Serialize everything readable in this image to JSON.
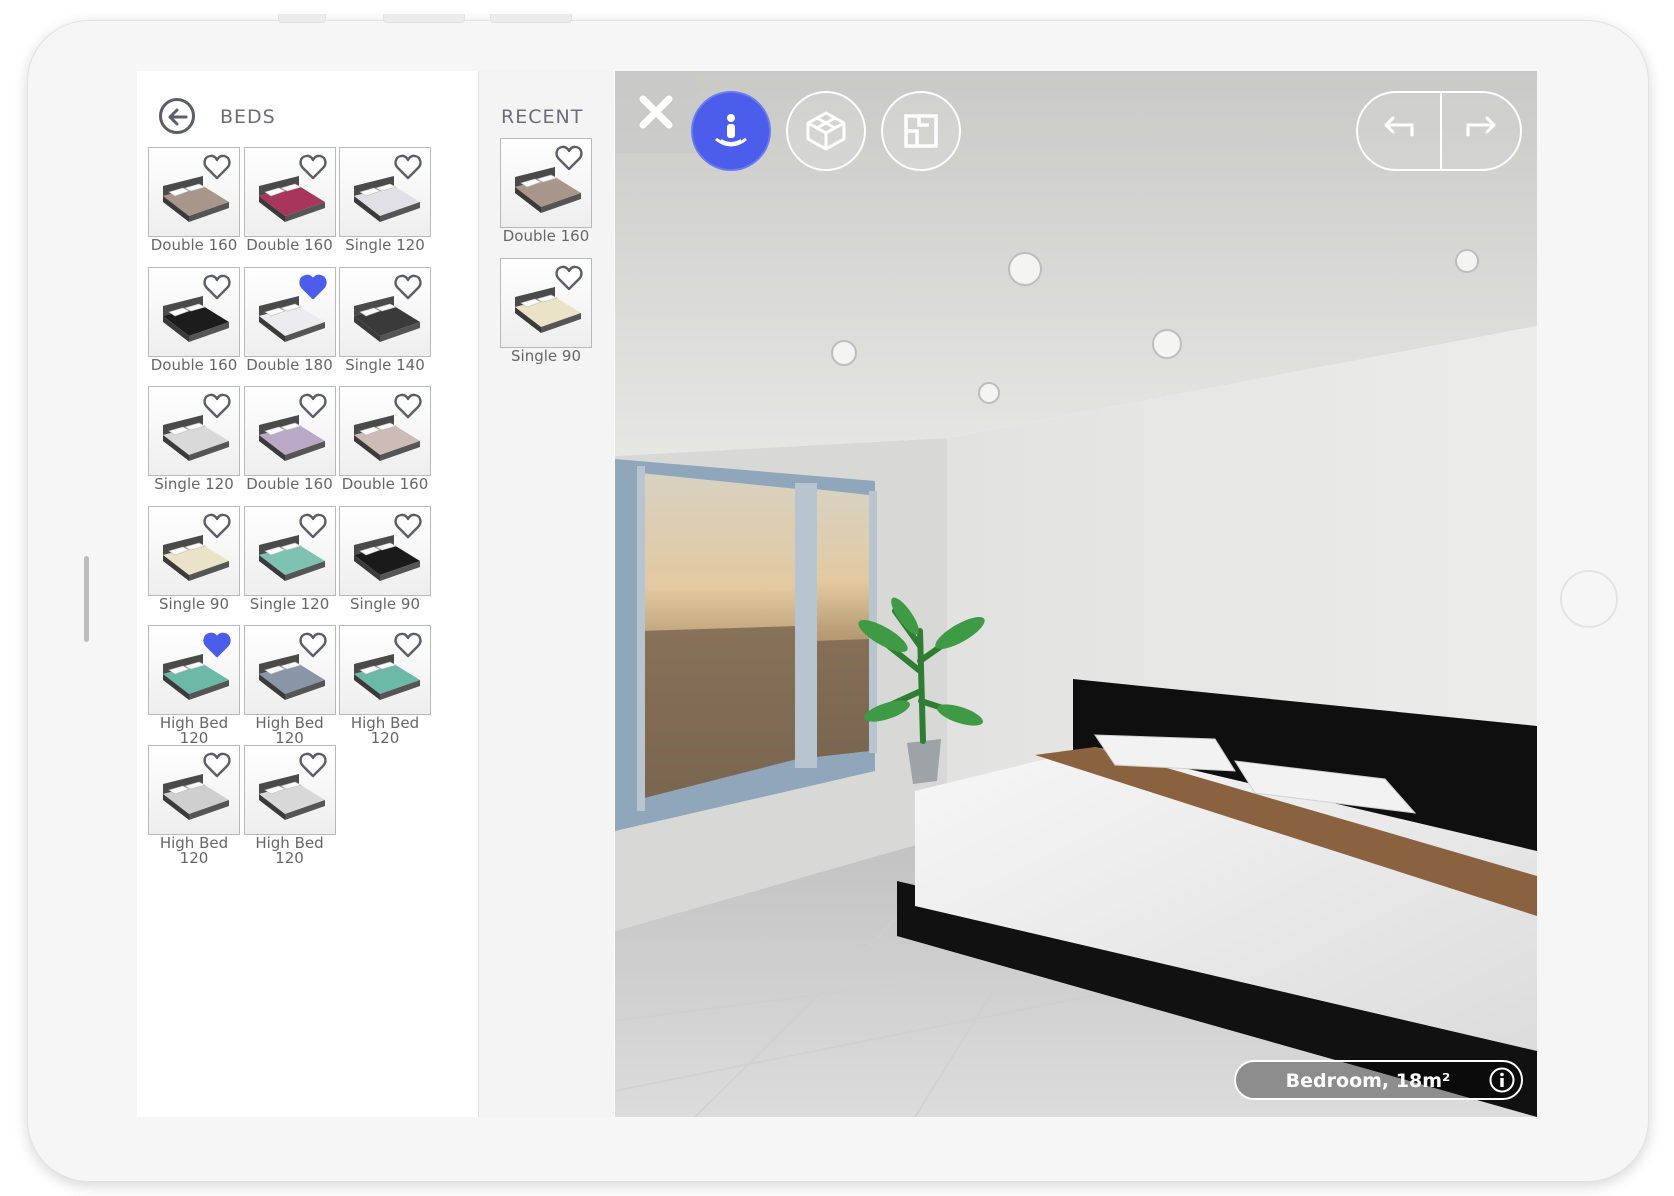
{
  "catalog": {
    "title": "BEDS",
    "items": [
      {
        "label": "Double 160",
        "favorite": false,
        "color": "#a9968a"
      },
      {
        "label": "Double 160",
        "favorite": false,
        "color": "#a8355c"
      },
      {
        "label": "Single 120",
        "favorite": false,
        "color": "#e0e0e6"
      },
      {
        "label": "Double 160",
        "favorite": false,
        "color": "#1c1c1c"
      },
      {
        "label": "Double 180",
        "favorite": true,
        "color": "#ececf0"
      },
      {
        "label": "Single 140",
        "favorite": false,
        "color": "#3a3a3a"
      },
      {
        "label": "Single 120",
        "favorite": false,
        "color": "#d9d9d9"
      },
      {
        "label": "Double 160",
        "favorite": false,
        "color": "#b9a8c6"
      },
      {
        "label": "Double 160",
        "favorite": false,
        "color": "#cdbcb6"
      },
      {
        "label": "Single 90",
        "favorite": false,
        "color": "#eae3c7"
      },
      {
        "label": "Single 120",
        "favorite": false,
        "color": "#7ec2b2"
      },
      {
        "label": "Single 90",
        "favorite": false,
        "color": "#1a1a1a"
      },
      {
        "label": "High Bed\n120",
        "favorite": true,
        "color": "#6cb9a8"
      },
      {
        "label": "High Bed\n120",
        "favorite": false,
        "color": "#8a95a8"
      },
      {
        "label": "High Bed\n120",
        "favorite": false,
        "color": "#6cb9a8"
      },
      {
        "label": "High Bed\n120",
        "favorite": false,
        "color": "#cfcfcf"
      },
      {
        "label": "High Bed\n120",
        "favorite": false,
        "color": "#d8d8d8"
      }
    ]
  },
  "recent": {
    "title": "RECENT",
    "items": [
      {
        "label": "Double 160",
        "favorite": false,
        "color": "#a9968a"
      },
      {
        "label": "Single 90",
        "favorite": false,
        "color": "#eae3c7"
      }
    ]
  },
  "viewport": {
    "active_mode": "walkthrough",
    "modes": [
      "walkthrough-icon",
      "3d-box-icon",
      "floorplan-icon"
    ],
    "room_label": "Bedroom, 18m²"
  },
  "colors": {
    "accent": "#4b5dea",
    "favorite": "#4b5dea",
    "text": "#6b6d79"
  }
}
